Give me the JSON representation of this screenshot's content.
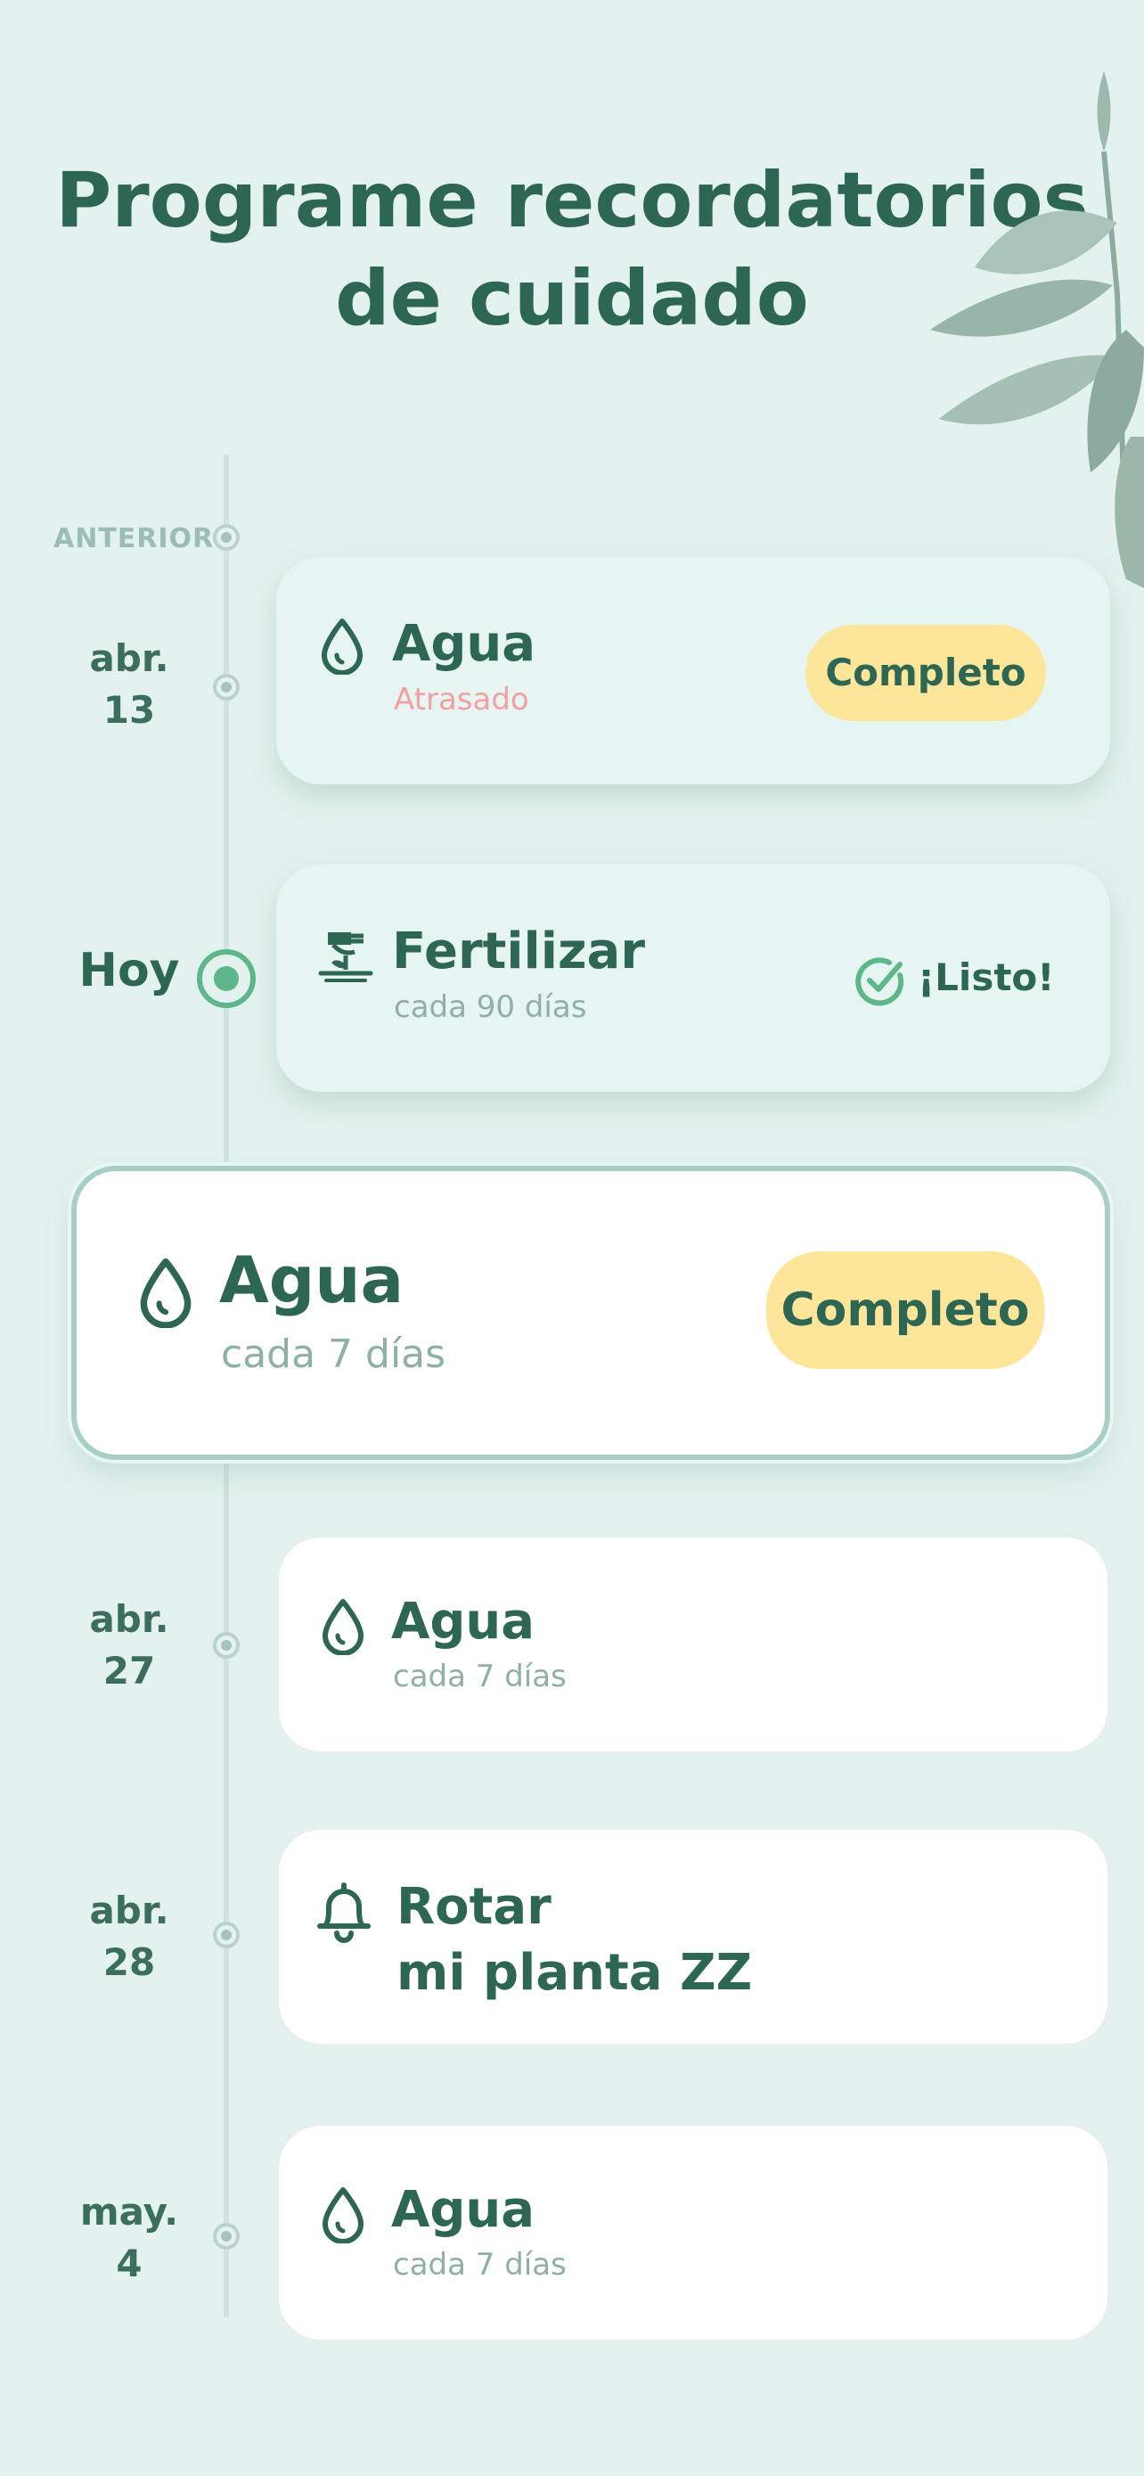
{
  "header": {
    "title_line1": "Programe recordatorios",
    "title_line2": "de cuidado"
  },
  "timeline": {
    "earlier_label": "ANTERIOR"
  },
  "reminders": [
    {
      "date_line1": "abr.",
      "date_line2": "13",
      "title": "Agua",
      "subtitle": "Atrasado",
      "action": "Completo",
      "icon": "water-drop-icon"
    },
    {
      "date_line1": "Hoy",
      "title": "Fertilizar",
      "subtitle": "cada 90 días",
      "status": "¡Listo!",
      "icon": "fertilize-icon"
    },
    {
      "title": "Agua",
      "subtitle": "cada 7 días",
      "action": "Completo",
      "icon": "water-drop-icon"
    },
    {
      "date_line1": "abr.",
      "date_line2": "27",
      "title": "Agua",
      "subtitle": "cada 7 días",
      "icon": "water-drop-icon"
    },
    {
      "date_line1": "abr.",
      "date_line2": "28",
      "title_line1": "Rotar",
      "title_line2": "mi planta ZZ",
      "icon": "bell-icon"
    },
    {
      "date_line1": "may.",
      "date_line2": "4",
      "title": "Agua",
      "subtitle": "cada 7 días",
      "icon": "water-drop-icon"
    }
  ],
  "colors": {
    "background": "#e3f2ee",
    "primary_text": "#2d6652",
    "accent_button": "#fde59a",
    "overdue": "#f2a0a0",
    "today_dot": "#5db78b"
  }
}
